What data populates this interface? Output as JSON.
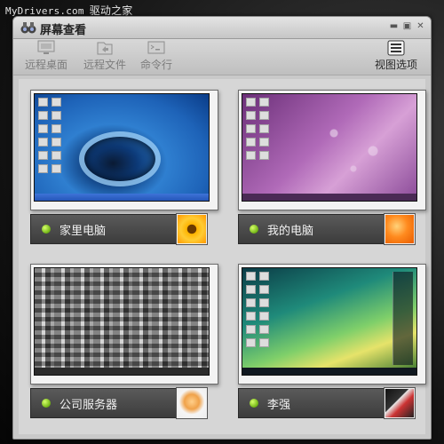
{
  "watermark": {
    "site": "MyDrivers.com",
    "cn": "驱动之家"
  },
  "window": {
    "title": "屏幕查看",
    "controls": [
      "minimize-icon",
      "maximize-icon",
      "close-icon"
    ]
  },
  "toolbar": {
    "items": [
      {
        "label": "远程桌面",
        "icon": "remote-desktop-icon",
        "enabled": false
      },
      {
        "label": "远程文件",
        "icon": "remote-files-icon",
        "enabled": false
      },
      {
        "label": "命令行",
        "icon": "command-line-icon",
        "enabled": false
      }
    ],
    "view_options": {
      "label": "视图选项",
      "icon": "view-options-icon"
    }
  },
  "computers": [
    {
      "name": "家里电脑",
      "status": "online",
      "status_color": "#7ac420",
      "wallpaper": "water-drop",
      "avatar": "sunflower"
    },
    {
      "name": "我的电脑",
      "status": "online",
      "status_color": "#7ac420",
      "wallpaper": "purple-droplets",
      "avatar": "orange-flower"
    },
    {
      "name": "公司服务器",
      "status": "online",
      "status_color": "#7ac420",
      "wallpaper": "gray-crowded-desktop",
      "avatar": "cartoon-character"
    },
    {
      "name": "李强",
      "status": "online",
      "status_color": "#7ac420",
      "wallpaper": "vista-aurora",
      "avatar": "origami-bird"
    }
  ]
}
